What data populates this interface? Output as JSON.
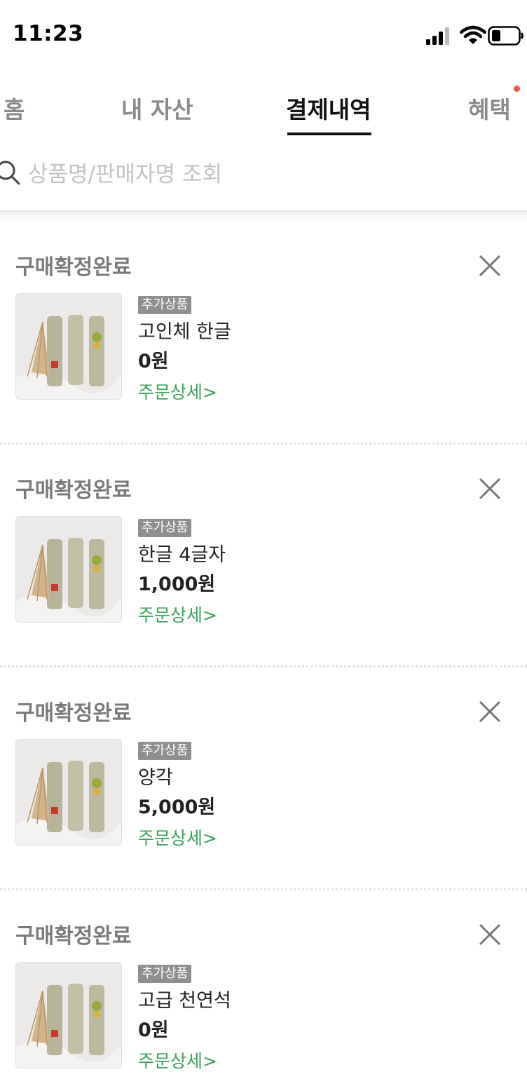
{
  "status_bar": {
    "time": "11:23"
  },
  "tabs": [
    {
      "label": "홈",
      "active": false
    },
    {
      "label": "내 자산",
      "active": false
    },
    {
      "label": "결제내역",
      "active": true
    },
    {
      "label": "혜택",
      "active": false,
      "has_notification": true
    }
  ],
  "search": {
    "placeholder": "상품명/판매자명 조회",
    "value": ""
  },
  "orders": [
    {
      "status": "구매확정완료",
      "badge": "추가상품",
      "name": "고인체 한글",
      "price": "0원",
      "detail_link": "주문상세>"
    },
    {
      "status": "구매확정완료",
      "badge": "추가상품",
      "name": "한글 4글자",
      "price": "1,000원",
      "detail_link": "주문상세>"
    },
    {
      "status": "구매확정완료",
      "badge": "추가상품",
      "name": "양각",
      "price": "5,000원",
      "detail_link": "주문상세>"
    },
    {
      "status": "구매확정완료",
      "badge": "추가상품",
      "name": "고급 천연석",
      "price": "0원",
      "detail_link": "주문상세>"
    }
  ],
  "colors": {
    "accent_green": "#3ea25d",
    "notification_dot": "#f0564a",
    "badge_bg": "#8f8f8f"
  }
}
